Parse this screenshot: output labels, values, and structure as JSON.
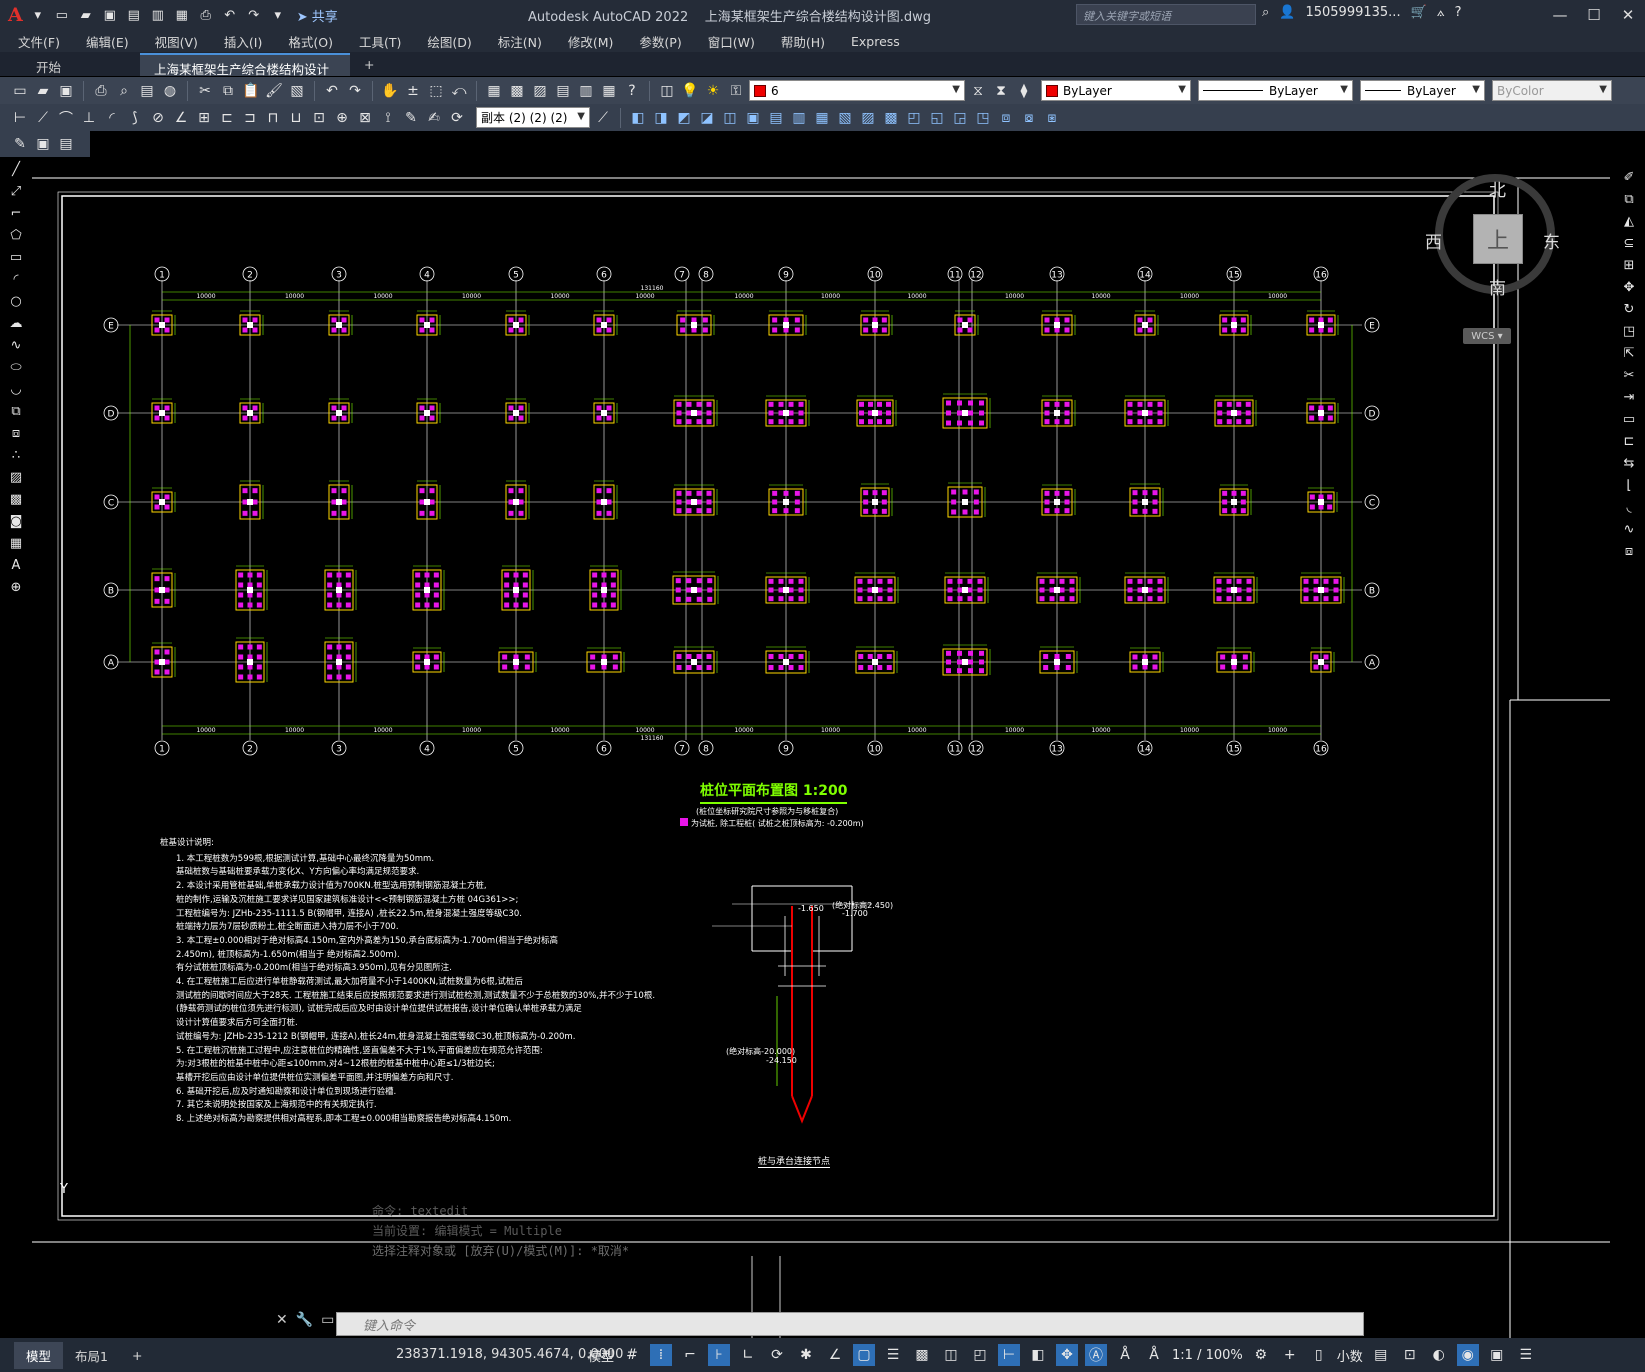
{
  "app_title": "Autodesk AutoCAD 2022",
  "doc_title": "上海某框架生产综合楼结构设计图.dwg",
  "share_label": "共享",
  "search_placeholder": "键入关键字或短语",
  "user": "1505999135...",
  "menu": [
    "文件(F)",
    "编辑(E)",
    "视图(V)",
    "插入(I)",
    "格式(O)",
    "工具(T)",
    "绘图(D)",
    "标注(N)",
    "修改(M)",
    "参数(P)",
    "窗口(W)",
    "帮助(H)",
    "Express"
  ],
  "tabs": {
    "start": "开始",
    "drawing": "上海某框架生产综合楼结构设计图*",
    "add": "+"
  },
  "toolbar": {
    "layer": "6",
    "color": "ByLayer",
    "linetype": "ByLayer",
    "lineweight": "ByLayer",
    "plotstyle": "ByColor",
    "dimstyle": "副本 (2) (2) (2)"
  },
  "viewcube": {
    "north": "北",
    "south": "南",
    "east": "东",
    "west": "西",
    "top": "上",
    "wcs": "WCS"
  },
  "drawing": {
    "axis_numbers": [
      "1",
      "2",
      "3",
      "4",
      "5",
      "6",
      "7",
      "8",
      "9",
      "10",
      "11",
      "12",
      "13",
      "14",
      "15",
      "16"
    ],
    "axis_letters": [
      "E",
      "D",
      "C",
      "B",
      "A"
    ],
    "span": "10000",
    "total": "131160",
    "title": "桩位平面布置图  1:200",
    "note1": "(桩位坐标研究院尺寸参照为与移桩复合)",
    "note2": "为试桩, 除工程桩( 试桩之桩顶标高为: -0.200m)",
    "notes_title": "桩基设计说明:",
    "notes": [
      "1. 本工程桩数为599根,根据测试计算,基础中心最终沉降量为50mm.",
      "   基础桩数与基础桩要承载力变化X、Y方向偏心率均满足规范要求.",
      "2. 本设计采用管桩基础,单桩承载力设计值为700KN.桩型选用预制钢筋混凝土方桩,",
      "   桩的制作,运输及沉桩施工要求详见国家建筑标准设计<<预制钢筋混凝土方桩 04G361>>;",
      "   工程桩编号为: JZHb-235-1111.5 B(钢帽甲, 连接A) ,桩长22.5m,桩身混凝土强度等级C30.",
      "   桩端持力层为7层砂质粉土,桩全断面进入持力层不小于700.",
      "3. 本工程±0.000相对于绝对标高4.150m,室内外高差为150,承台底标高为-1.700m(相当于绝对标高",
      "   2.450m), 桩顶标高为-1.650m(相当于 绝对标高2.500m).",
      "   有分试桩桩顶标高为-0.200m(相当于绝对标高3.950m),见有分见图所注.",
      "4. 在工程桩施工后应进行单桩静载荷测试,最大加荷量不小于1400KN,试桩数量为6根,试桩后",
      "   测试桩的间歇时间应大于28天. 工程桩施工结束后应按照规范要求进行测试桩检测,测试数量不少于总桩数的30%,并不少于10根.",
      "   (静载荷测试的桩位须先进行标测),  试桩完成后应及时由设计单位提供试桩报告,设计单位确认单桩承载力满足",
      "   设计计算值要求后方可全面打桩.",
      "   试桩编号为: JZHb-235-1212 B(钢帽甲, 连接A),桩长24m,桩身混凝土强度等级C30,桩顶标高为-0.200m.",
      "5. 在工程桩沉桩施工过程中,应注意桩位的精确性,竖直偏差不大于1%,平面偏差应在规范允许范围:",
      "   为:对3根桩的桩基中桩中心距≤100mm,对4~12根桩的桩基中桩中心距≤1/3桩边长;",
      "   基槽开挖后应由设计单位提供桩位实测偏差平面图,并注明偏差方向和尺寸.",
      "6. 基础开挖后,应及时通知勘察和设计单位到现场进行验槽.",
      "7. 其它未说明处按国家及上海规范中的有关规定执行.",
      "8. 上述绝对标高为勘察提供相对高程系,即本工程±0.000相当勘察报告绝对标高4.150m."
    ],
    "detail_title": "桩与承台连接节点",
    "detail_l1": "(绝对标高2.450)",
    "detail_l2": "-1.700",
    "detail_l3": "-1.650",
    "detail_l4": "(绝对标高-20.000)",
    "detail_l5": "-24.150",
    "axis_y": "Y"
  },
  "command": {
    "h1": "命令:  textedit",
    "h2": "当前设置: 编辑模式 = Multiple",
    "h3": "选择注释对象或 [放弃(U)/模式(M)]: *取消*",
    "placeholder": "键入命令"
  },
  "status": {
    "layout_model": "模型",
    "layout1": "布局1",
    "add": "+",
    "coords": "238371.1918, 94305.4674, 0.0000",
    "space": "模型",
    "scale": "1:1 / 100%",
    "units": "小数"
  },
  "colors": {
    "pile": "#e815e8",
    "axis": "#ffffff",
    "dim": "#7fff00",
    "grid": "#ffffff",
    "text": "#ffffff"
  }
}
